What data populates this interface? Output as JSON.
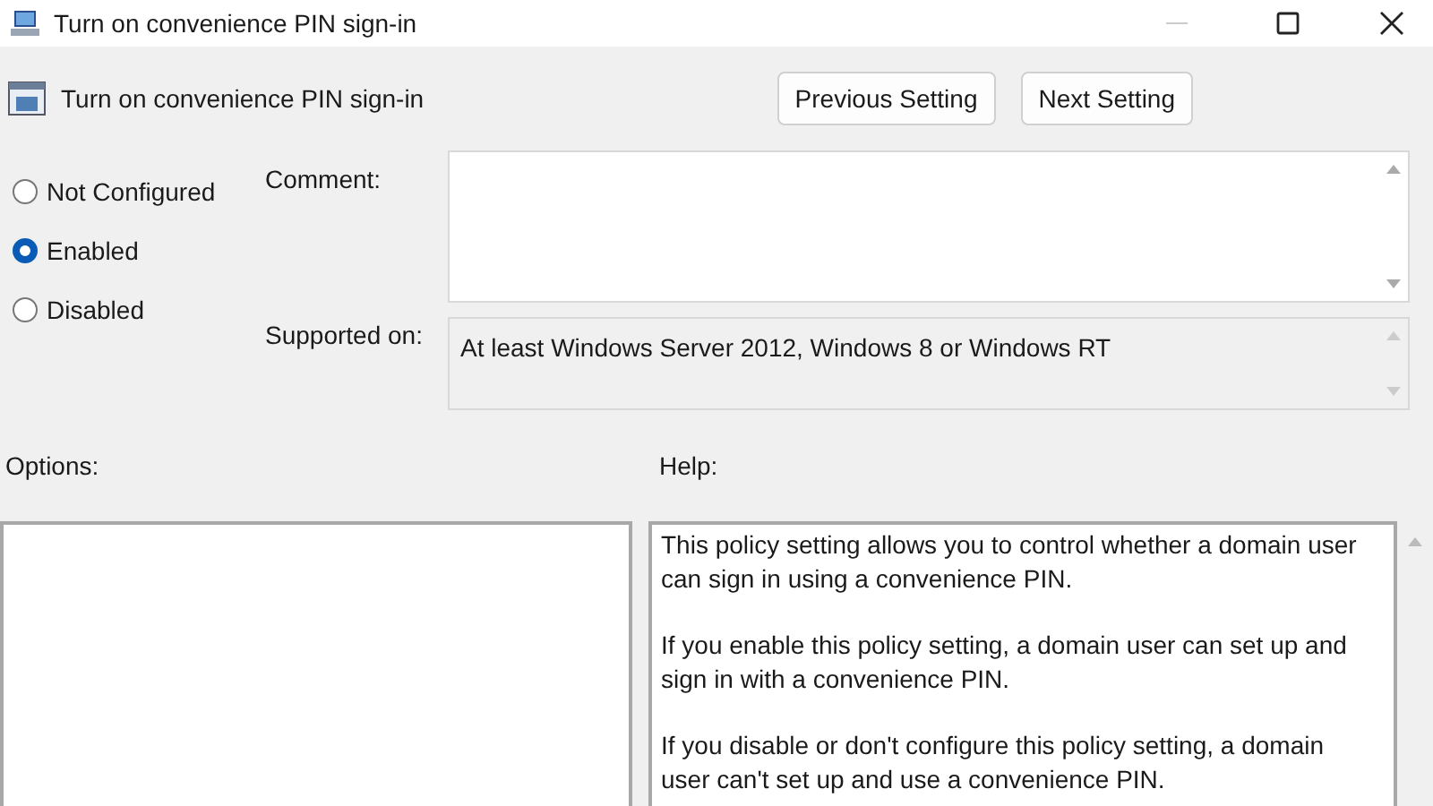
{
  "window": {
    "title": "Turn on convenience PIN sign-in"
  },
  "header": {
    "title": "Turn on convenience PIN sign-in"
  },
  "buttons": [
    "Previous Setting",
    "Next Setting"
  ],
  "states": [
    {
      "label": "Not Configured",
      "selected": false
    },
    {
      "label": "Enabled",
      "selected": true
    },
    {
      "label": "Disabled",
      "selected": false
    }
  ],
  "comment": {
    "label": "Comment:"
  },
  "supported_on": {
    "label": "Supported on:",
    "value": "At least Windows Server 2012, Windows 8 or Windows RT"
  },
  "options": {
    "label": "Options:"
  },
  "help": {
    "label": "Help:",
    "paragraphs": [
      "This policy setting allows you to control whether a domain user can sign in using a convenience PIN.",
      "If you enable this policy setting, a domain user can set up and sign in with a convenience PIN.",
      "If you disable or don't configure this policy setting, a domain user can't set up and use a convenience PIN."
    ]
  }
}
